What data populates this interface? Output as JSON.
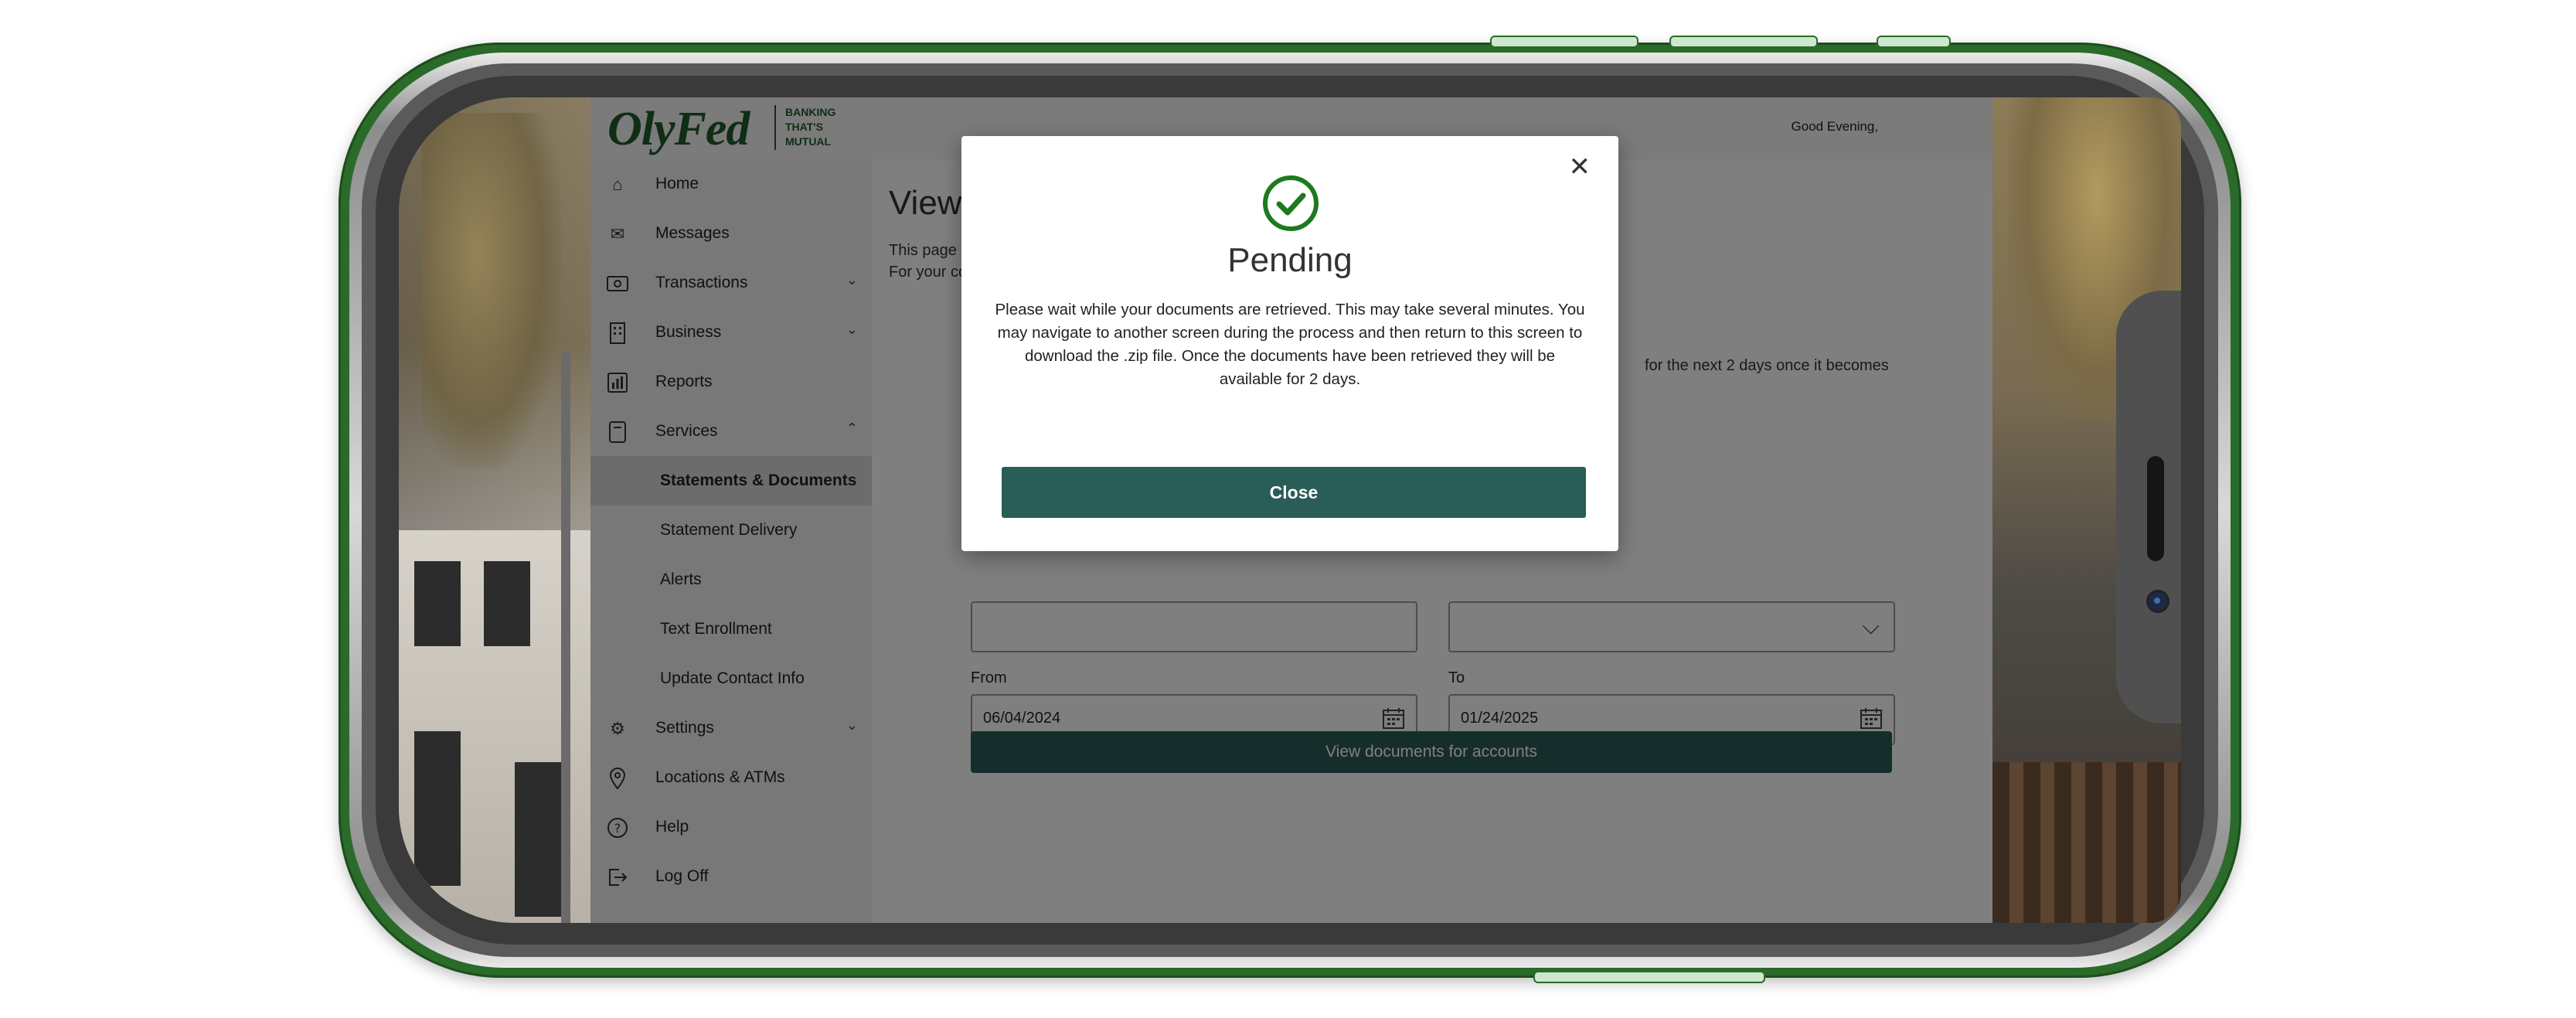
{
  "header": {
    "logo": "OlyFed",
    "tagline": [
      "BANKING",
      "THAT'S",
      "MUTUAL"
    ],
    "greeting": "Good Evening,"
  },
  "sidebar": {
    "items": [
      {
        "label": "Home",
        "icon": "home-icon"
      },
      {
        "label": "Messages",
        "icon": "envelope-icon"
      },
      {
        "label": "Transactions",
        "icon": "money-icon",
        "chevron": "down"
      },
      {
        "label": "Business",
        "icon": "building-icon",
        "chevron": "down"
      },
      {
        "label": "Reports",
        "icon": "bar-chart-icon"
      },
      {
        "label": "Services",
        "icon": "document-icon",
        "chevron": "up"
      },
      {
        "label": "Statements & Documents",
        "sub": true,
        "active": true
      },
      {
        "label": "Statement Delivery",
        "sub": true
      },
      {
        "label": "Alerts",
        "sub": true
      },
      {
        "label": "Text Enrollment",
        "sub": true
      },
      {
        "label": "Update Contact Info",
        "sub": true
      },
      {
        "label": "Settings",
        "icon": "gear-icon",
        "chevron": "down"
      },
      {
        "label": "Locations & ATMs",
        "icon": "location-pin-icon"
      },
      {
        "label": "Help",
        "icon": "help-icon"
      },
      {
        "label": "Log Off",
        "icon": "logout-icon"
      }
    ]
  },
  "main": {
    "title_partial": "View",
    "desc_line1_partial": "This page a",
    "desc_line2_partial": "For your co",
    "partial_right_text": "for the next 2 days once it becomes",
    "from_label": "From",
    "from_value": "06/04/2024",
    "to_label": "To",
    "to_value": "01/24/2025",
    "view_button": "View documents for accounts"
  },
  "modal": {
    "title": "Pending",
    "message": "Please wait while your documents are retrieved. This may take several minutes. You may navigate to another screen during the process and then return to this screen to download the .zip file. Once the documents have been retrieved they will be available for 2 days.",
    "close_button": "Close"
  },
  "colors": {
    "brand_green": "#205a2a",
    "button_teal": "#2a5c58",
    "success_green": "#1e7a1e"
  }
}
